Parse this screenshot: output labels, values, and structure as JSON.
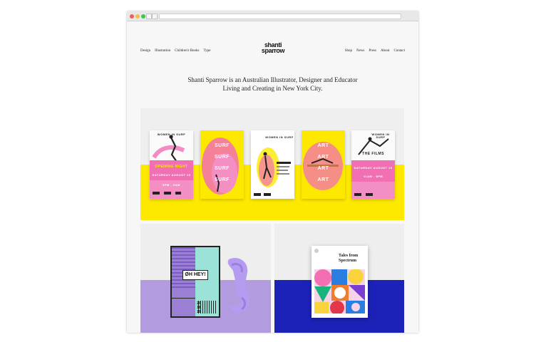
{
  "nav": {
    "left": [
      "Design",
      "Illustration",
      "Children's Books",
      "Type"
    ],
    "right": [
      "Shop",
      "News",
      "Press",
      "About",
      "Contact"
    ]
  },
  "logo": {
    "line1": "shanti",
    "line2": "sparrow"
  },
  "tagline": {
    "line1": "Shanti Sparrow is an Australian Illustrator, Designer and Educator",
    "line2": "Living and Creating in New York City."
  },
  "posters": [
    {
      "type": "women-surf",
      "heading": "WOMEN IN SURF",
      "event": "OPENING NIGHT",
      "date": "SATURDAY AUGUST 15",
      "time": "5PM - 9AM"
    },
    {
      "type": "surf",
      "words": [
        "SURF",
        "SURF",
        "SURF",
        "SURF"
      ]
    },
    {
      "type": "women-surf-lap",
      "heading": "WOMEN IN SURF"
    },
    {
      "type": "art",
      "words": [
        "ART",
        "ART",
        "ART",
        "ART"
      ]
    },
    {
      "type": "women-surf",
      "heading": "WOMEN IN SURF",
      "event": "THE FILMS",
      "date": "SATURDAY AUGUST 15",
      "time": "11AM - 8PM"
    }
  ],
  "book": {
    "badge": "ØH HEY!",
    "nums": [
      "20",
      "18",
      "19"
    ]
  },
  "cover": {
    "title": "Tales from Spectrum"
  },
  "colors": {
    "yellow": "#fde900",
    "pink": "#f26fb3",
    "lavender": "#b39be0",
    "mint": "#9be3d9",
    "blue": "#1c22b8"
  }
}
